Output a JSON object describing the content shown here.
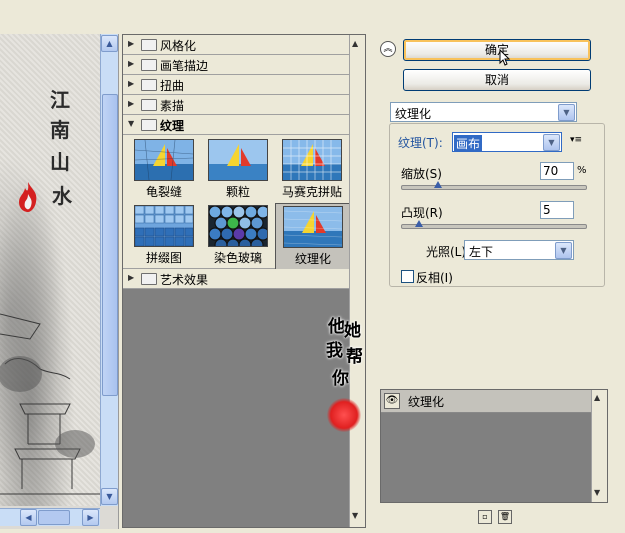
{
  "preview": {
    "calligraphy": [
      "江",
      "南",
      "山",
      "水"
    ]
  },
  "gallery": {
    "categories_top": [
      {
        "label": "风格化",
        "open": false
      },
      {
        "label": "画笔描边",
        "open": false
      },
      {
        "label": "扭曲",
        "open": false
      },
      {
        "label": "素描",
        "open": false
      },
      {
        "label": "纹理",
        "open": true
      }
    ],
    "thumbnails": [
      {
        "label": "龟裂缝",
        "selected": false
      },
      {
        "label": "颗粒",
        "selected": false
      },
      {
        "label": "马赛克拼贴",
        "selected": false
      },
      {
        "label": "拼缀图",
        "selected": false
      },
      {
        "label": "染色玻璃",
        "selected": false
      },
      {
        "label": "纹理化",
        "selected": true
      }
    ],
    "categories_bottom": [
      {
        "label": "艺术效果",
        "open": false
      }
    ]
  },
  "panel": {
    "ok_label": "确定",
    "cancel_label": "取消",
    "filter_select": "纹理化",
    "texture_label": "纹理(T):",
    "texture_value": "画布",
    "scaling_label": "缩放(S)",
    "scaling_value": "70",
    "scaling_unit": "%",
    "scaling_fraction": 0.2,
    "relief_label": "凸现(R)",
    "relief_value": "5",
    "relief_fraction": 0.1,
    "light_label": "光照(L):",
    "light_value": "左下",
    "invert_label": "反相(I)",
    "invert_checked": false
  },
  "layers": {
    "active_layer": "纹理化"
  },
  "overlay": {
    "brush_text": [
      "他",
      "她",
      "我",
      "帮",
      "你"
    ]
  },
  "colors": {
    "accent_blue": "#316ac5",
    "stamp_red": "#e02020",
    "gallery_bg": "#808080"
  }
}
